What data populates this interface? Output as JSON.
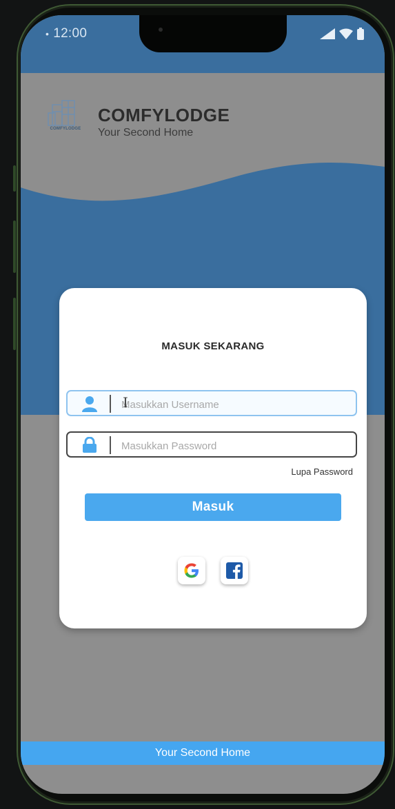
{
  "status_bar": {
    "time": "12:00"
  },
  "header": {
    "logo_text": "COMFYLODGE",
    "brand_name": "COMFYLODGE",
    "tagline": "Your Second Home"
  },
  "login_card": {
    "title": "MASUK SEKARANG",
    "username_placeholder": "Masukkan Username",
    "password_placeholder": "Masukkan Password",
    "forgot_password": "Lupa Password",
    "submit_label": "Masuk"
  },
  "social_login": [
    {
      "name": "google",
      "icon": "google-icon"
    },
    {
      "name": "facebook",
      "icon": "facebook-icon"
    }
  ],
  "footer": {
    "text": "Your Second Home"
  },
  "colors": {
    "primary_blue": "#3a6e9e",
    "accent_blue": "#4aa8ee",
    "background_gray": "#8e8e8e"
  }
}
